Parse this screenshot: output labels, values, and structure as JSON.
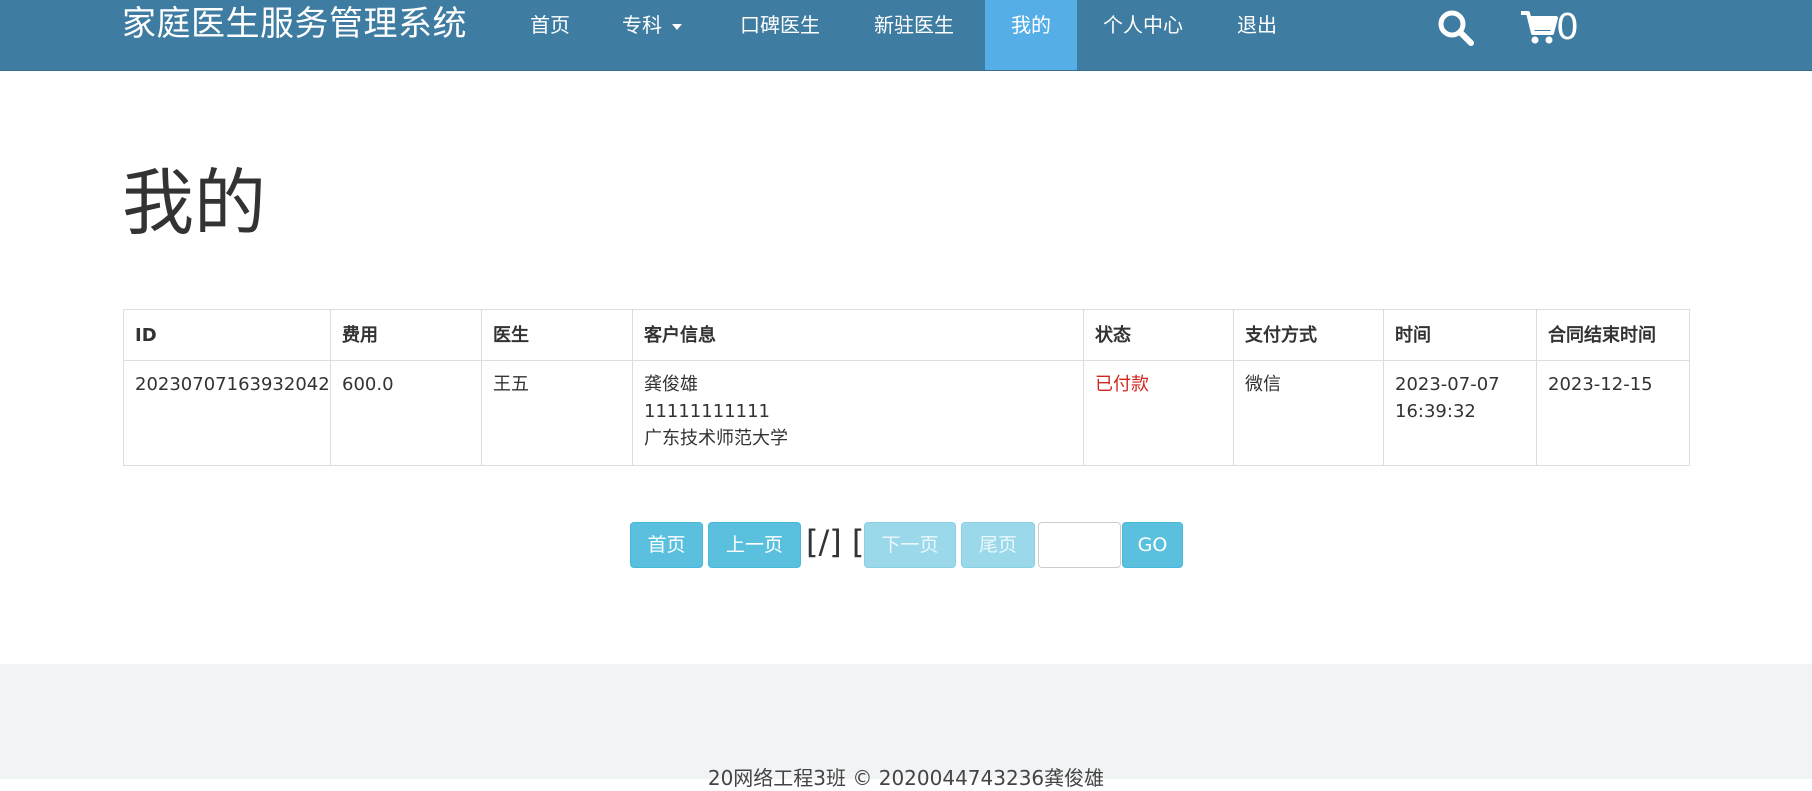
{
  "navbar": {
    "brand": "家庭医生服务管理系统",
    "items": [
      {
        "label": "首页"
      },
      {
        "label": "专科"
      },
      {
        "label": "口碑医生"
      },
      {
        "label": "新驻医生"
      },
      {
        "label": "我的"
      },
      {
        "label": "个人中心"
      },
      {
        "label": "退出"
      }
    ],
    "active": "我的",
    "search_icon": "search-icon",
    "cart_icon": "cart-icon",
    "cart_count": "0",
    "colors": {
      "bar": "#3f7ca2",
      "active": "#56aee6"
    }
  },
  "page": {
    "title": "我的"
  },
  "table": {
    "headers": [
      "ID",
      "费用",
      "医生",
      "客户信息",
      "状态",
      "支付方式",
      "时间",
      "合同结束时间"
    ],
    "rows": [
      {
        "id": "20230707163932042",
        "fee": "600.0",
        "doctor": "王五",
        "customer": {
          "name": "龚俊雄",
          "phone": "11111111111",
          "address": "广东技术师范大学"
        },
        "status": "已付款",
        "payment": "微信",
        "time": "2023-07-07 16:39:32",
        "contract_end": "2023-12-15"
      }
    ],
    "status_color": "#d0251c"
  },
  "pagination": {
    "first": "首页",
    "prev": "上一页",
    "info": "[/] []",
    "next": "下一页",
    "last": "尾页",
    "input_value": "",
    "go": "GO",
    "button_color": "#5bc0de"
  },
  "footer": {
    "text": "20网络工程3班 © 2020044743236龚俊雄"
  }
}
